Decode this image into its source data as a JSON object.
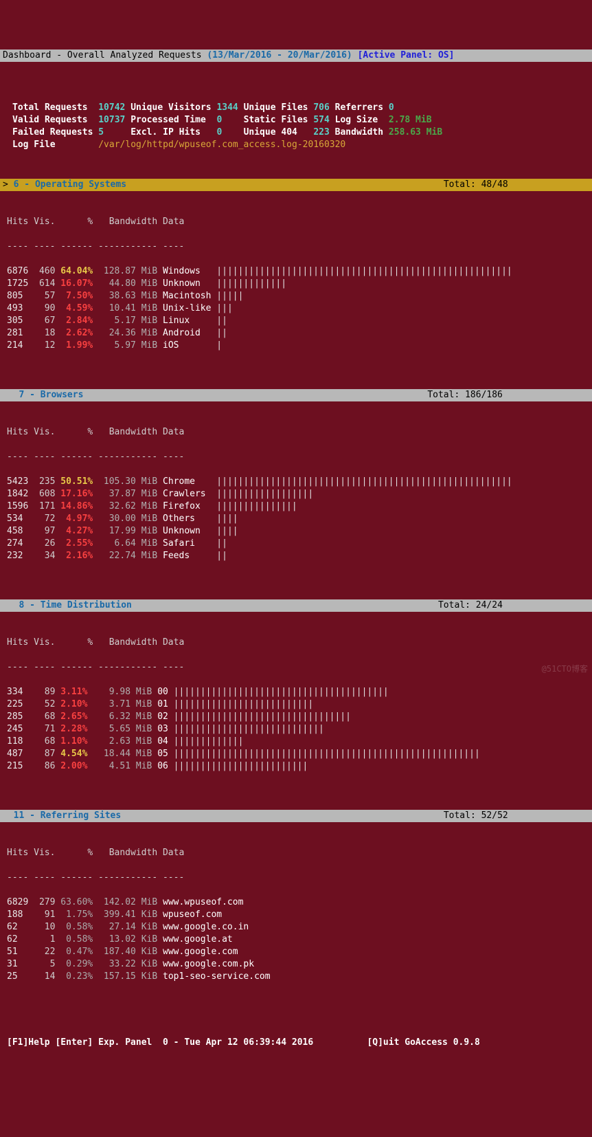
{
  "title": {
    "left": "Dashboard - Overall Analyzed Requests ",
    "dates": "(13/Mar/2016 - 20/Mar/2016)",
    "right": "[Active Panel: OS]"
  },
  "summary": {
    "total_requests_lbl": "Total Requests ",
    "total_requests": "10742",
    "unique_visitors_lbl": "Unique Visitors",
    "unique_visitors": "1344",
    "unique_files_lbl": "Unique Files",
    "unique_files": "706",
    "referrers_lbl": "Referrers",
    "referrers": "0",
    "valid_requests_lbl": "Valid Requests ",
    "valid_requests": "10737",
    "processed_time_lbl": "Processed Time ",
    "processed_time": "0",
    "static_files_lbl": "Static Files",
    "static_files": "574",
    "log_size_lbl": "Log Size ",
    "log_size": "2.78 MiB",
    "failed_requests_lbl": "Failed Requests",
    "failed_requests": "5",
    "excl_ip_lbl": "Excl. IP Hits  ",
    "excl_ip": "0",
    "unique_404_lbl": "Unique 404  ",
    "unique_404": "223",
    "bandwidth_lbl": "Bandwidth",
    "bandwidth": "258.63 MiB",
    "log_file_lbl": "Log File       ",
    "log_file": "/var/log/httpd/wpuseof.com_access.log-20160320"
  },
  "panels": {
    "os": {
      "title": "6 - Operating Systems",
      "prefix": "> ",
      "total": "Total: 48/48"
    },
    "browsers": {
      "title": "7 - Browsers",
      "total": "Total: 186/186"
    },
    "time": {
      "title": "8 - Time Distribution",
      "total": "Total: 24/24"
    },
    "referring": {
      "title": "11 - Referring Sites",
      "total": "Total: 52/52"
    }
  },
  "cols_hdr": "Hits Vis.      %   Bandwidth Data",
  "cols_sep": "---- ---- ------ ----------- ----",
  "os_rows": [
    {
      "hits": "6876",
      "vis": "460",
      "pct": "64.04%",
      "bw": "128.87",
      "unit": "MiB",
      "data": "Windows  ",
      "bar": "|||||||||||||||||||||||||||||||||||||||||||||||||||||||",
      "pct_style": "pct-yel-b"
    },
    {
      "hits": "1725",
      "vis": "614",
      "pct": "16.07%",
      "bw": " 44.80",
      "unit": "MiB",
      "data": "Unknown  ",
      "bar": "|||||||||||||",
      "pct_style": "pct-red-b"
    },
    {
      "hits": "805 ",
      "vis": " 57",
      "pct": " 7.50%",
      "bw": " 38.63",
      "unit": "MiB",
      "data": "Macintosh",
      "bar": "|||||",
      "pct_style": "pct-red-b"
    },
    {
      "hits": "493 ",
      "vis": " 90",
      "pct": " 4.59%",
      "bw": " 10.41",
      "unit": "MiB",
      "data": "Unix-like",
      "bar": "|||",
      "pct_style": "pct-red-b"
    },
    {
      "hits": "305 ",
      "vis": " 67",
      "pct": " 2.84%",
      "bw": "  5.17",
      "unit": "MiB",
      "data": "Linux    ",
      "bar": "||",
      "pct_style": "pct-red-b"
    },
    {
      "hits": "281 ",
      "vis": " 18",
      "pct": " 2.62%",
      "bw": " 24.36",
      "unit": "MiB",
      "data": "Android  ",
      "bar": "||",
      "pct_style": "pct-red-b"
    },
    {
      "hits": "214 ",
      "vis": " 12",
      "pct": " 1.99%",
      "bw": "  5.97",
      "unit": "MiB",
      "data": "iOS      ",
      "bar": "|",
      "pct_style": "pct-red-b"
    }
  ],
  "browser_rows": [
    {
      "hits": "5423",
      "vis": "235",
      "pct": "50.51%",
      "bw": "105.30",
      "unit": "MiB",
      "data": "Chrome   ",
      "bar": "|||||||||||||||||||||||||||||||||||||||||||||||||||||||",
      "pct_style": "pct-yel-b"
    },
    {
      "hits": "1842",
      "vis": "608",
      "pct": "17.16%",
      "bw": " 37.87",
      "unit": "MiB",
      "data": "Crawlers ",
      "bar": "||||||||||||||||||",
      "pct_style": "pct-red-b"
    },
    {
      "hits": "1596",
      "vis": "171",
      "pct": "14.86%",
      "bw": " 32.62",
      "unit": "MiB",
      "data": "Firefox  ",
      "bar": "|||||||||||||||",
      "pct_style": "pct-red-b"
    },
    {
      "hits": "534 ",
      "vis": " 72",
      "pct": " 4.97%",
      "bw": " 30.00",
      "unit": "MiB",
      "data": "Others   ",
      "bar": "||||",
      "pct_style": "pct-red-b"
    },
    {
      "hits": "458 ",
      "vis": " 97",
      "pct": " 4.27%",
      "bw": " 17.99",
      "unit": "MiB",
      "data": "Unknown  ",
      "bar": "||||",
      "pct_style": "pct-red-b"
    },
    {
      "hits": "274 ",
      "vis": " 26",
      "pct": " 2.55%",
      "bw": "  6.64",
      "unit": "MiB",
      "data": "Safari   ",
      "bar": "||",
      "pct_style": "pct-red-b"
    },
    {
      "hits": "232 ",
      "vis": " 34",
      "pct": " 2.16%",
      "bw": " 22.74",
      "unit": "MiB",
      "data": "Feeds    ",
      "bar": "||",
      "pct_style": "pct-red-b"
    }
  ],
  "time_rows": [
    {
      "hits": "334 ",
      "vis": " 89",
      "pct": "3.11%",
      "bw": "  9.98",
      "unit": "MiB",
      "data": "00",
      "bar": "||||||||||||||||||||||||||||||||||||||||",
      "pct_style": "pct-red-b"
    },
    {
      "hits": "225 ",
      "vis": " 52",
      "pct": "2.10%",
      "bw": "  3.71",
      "unit": "MiB",
      "data": "01",
      "bar": "||||||||||||||||||||||||||",
      "pct_style": "pct-red-b"
    },
    {
      "hits": "285 ",
      "vis": " 68",
      "pct": "2.65%",
      "bw": "  6.32",
      "unit": "MiB",
      "data": "02",
      "bar": "|||||||||||||||||||||||||||||||||",
      "pct_style": "pct-red-b"
    },
    {
      "hits": "245 ",
      "vis": " 71",
      "pct": "2.28%",
      "bw": "  5.65",
      "unit": "MiB",
      "data": "03",
      "bar": "||||||||||||||||||||||||||||",
      "pct_style": "pct-red-b"
    },
    {
      "hits": "118 ",
      "vis": " 68",
      "pct": "1.10%",
      "bw": "  2.63",
      "unit": "MiB",
      "data": "04",
      "bar": "|||||||||||||",
      "pct_style": "pct-red-b"
    },
    {
      "hits": "487 ",
      "vis": " 87",
      "pct": "4.54%",
      "bw": " 18.44",
      "unit": "MiB",
      "data": "05",
      "bar": "|||||||||||||||||||||||||||||||||||||||||||||||||||||||||",
      "pct_style": "pct-yel-b"
    },
    {
      "hits": "215 ",
      "vis": " 86",
      "pct": "2.00%",
      "bw": "  4.51",
      "unit": "MiB",
      "data": "06",
      "bar": "|||||||||||||||||||||||||",
      "pct_style": "pct-red-b"
    }
  ],
  "ref_rows": [
    {
      "hits": "6829",
      "vis": "279",
      "pct": "63.60%",
      "bw": "142.02",
      "unit": "MiB",
      "data": "www.wpuseof.com",
      "pct_style": "pct-grey"
    },
    {
      "hits": "188 ",
      "vis": " 91",
      "pct": " 1.75%",
      "bw": "399.41",
      "unit": "KiB",
      "data": "wpuseof.com",
      "pct_style": "pct-grey"
    },
    {
      "hits": "62  ",
      "vis": " 10",
      "pct": " 0.58%",
      "bw": " 27.14",
      "unit": "KiB",
      "data": "www.google.co.in",
      "pct_style": "pct-grey"
    },
    {
      "hits": "62  ",
      "vis": "  1",
      "pct": " 0.58%",
      "bw": " 13.02",
      "unit": "KiB",
      "data": "www.google.at",
      "pct_style": "pct-grey"
    },
    {
      "hits": "51  ",
      "vis": " 22",
      "pct": " 0.47%",
      "bw": "187.40",
      "unit": "KiB",
      "data": "www.google.com",
      "pct_style": "pct-grey"
    },
    {
      "hits": "31  ",
      "vis": "  5",
      "pct": " 0.29%",
      "bw": " 33.22",
      "unit": "KiB",
      "data": "www.google.com.pk",
      "pct_style": "pct-grey"
    },
    {
      "hits": "25  ",
      "vis": " 14",
      "pct": " 0.23%",
      "bw": "157.15",
      "unit": "KiB",
      "data": "top1-seo-service.com",
      "pct_style": "pct-grey"
    }
  ],
  "footer": {
    "help": "[F1]Help",
    "enter": "[Enter]",
    "exp": "Exp. Panel",
    "zero": "0 -",
    "date": "Tue Apr 12 06:39:44 2016",
    "quit": "[Q]uit",
    "app": "GoAccess 0.9.8"
  },
  "watermark": "@51CTO博客"
}
